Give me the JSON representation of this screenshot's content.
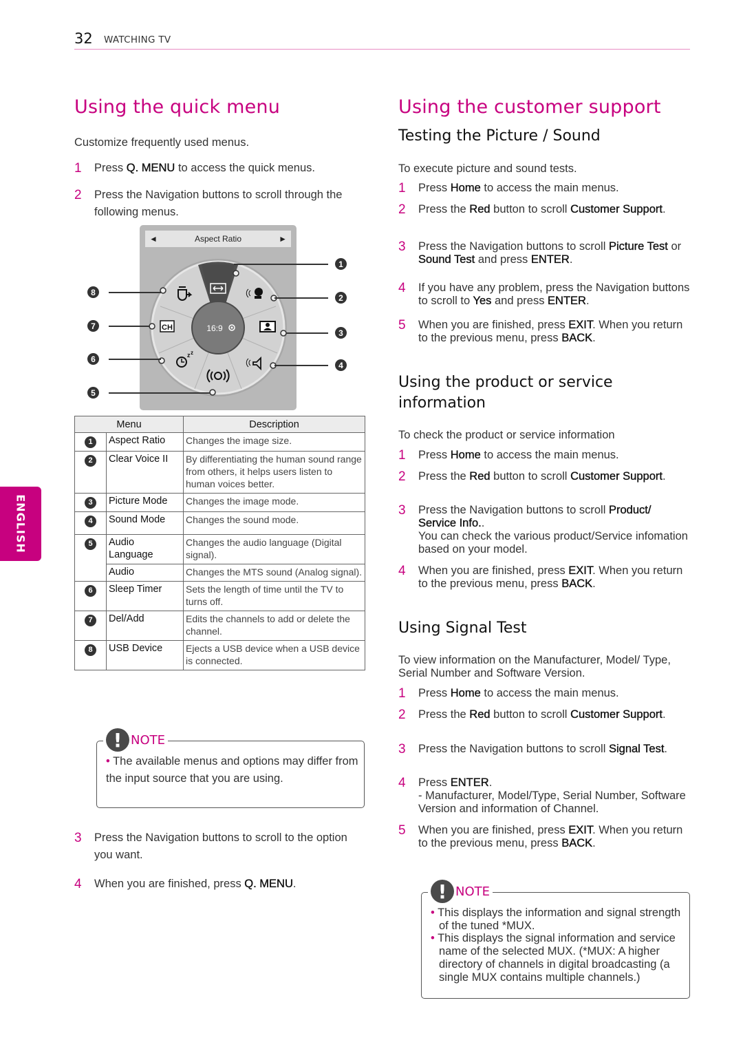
{
  "header": {
    "page_number": "32",
    "chapter": "WATCHING TV"
  },
  "side_tab": {
    "label": "ENGLISH"
  },
  "colors": {
    "accent": "#c7017f",
    "header_line": "#e88cc4"
  },
  "quick_menu": {
    "title": "Using the quick menu",
    "intro": "Customize frequently used menus.",
    "steps": [
      {
        "num": "1",
        "pre": "Press ",
        "b1": "Q. MENU",
        "post": " to access the quick menus."
      },
      {
        "num": "2",
        "text": "Press the Navigation buttons to scroll through the following menus."
      },
      {
        "num": "3",
        "text": "Press the Navigation buttons to scroll to the option you want."
      },
      {
        "num": "4",
        "pre": "When you are finished, press ",
        "b1": "Q. MENU",
        "post": "."
      }
    ],
    "diagram": {
      "title_bar": "Aspect Ratio",
      "left_arrow": "◄",
      "right_arrow": "►",
      "center_label": "16:9 ◉",
      "callouts": [
        "1",
        "2",
        "3",
        "4",
        "5",
        "6",
        "7",
        "8"
      ],
      "icons": [
        "aspect-ratio-icon",
        "clear-voice-icon",
        "picture-mode-icon",
        "sound-mode-icon",
        "audio-icon",
        "sleep-timer-icon",
        "ch-icon",
        "usb-eject-icon"
      ]
    },
    "table": {
      "headers": [
        "Menu",
        "Description"
      ],
      "rows": [
        {
          "num": "1",
          "menu": "Aspect Ratio",
          "desc": "Changes the image size."
        },
        {
          "num": "2",
          "menu": "Clear Voice II",
          "desc": "By differentiating the human sound range from others, it helps users listen to human voices better."
        },
        {
          "num": "3",
          "menu": "Picture Mode",
          "desc": "Changes the image mode."
        },
        {
          "num": "4",
          "menu": "Sound Mode",
          "desc": "Changes the sound mode."
        },
        {
          "num": "5",
          "menu": "Audio Language",
          "desc": "Changes the audio language (Digital signal)."
        },
        {
          "num": "",
          "menu": "Audio",
          "desc": "Changes the MTS sound (Analog signal)."
        },
        {
          "num": "6",
          "menu": "Sleep Timer",
          "desc": "Sets the length of time until the TV to turns off."
        },
        {
          "num": "7",
          "menu": "Del/Add",
          "desc": "Edits the channels to add or delete the channel."
        },
        {
          "num": "8",
          "menu": "USB Device",
          "desc": "Ejects a USB device when a USB device is connected."
        }
      ]
    },
    "note": {
      "label": "NOTE",
      "items": [
        "The available menus and options may differ from the input source that you are using."
      ]
    }
  },
  "customer_support": {
    "title": "Using the customer support",
    "picture_sound": {
      "title": "Testing the Picture / Sound",
      "intro": "To execute picture and sound tests.",
      "steps": [
        {
          "num": "1",
          "pre": "Press ",
          "b1": "Home",
          "post": " to access the main menus."
        },
        {
          "num": "2",
          "pre": "Press the ",
          "b1": "Red",
          "mid": " button to scroll ",
          "b2": "Customer Support",
          "post": "."
        },
        {
          "num": "3",
          "pre": "Press the Navigation buttons to scroll ",
          "b1": "Picture Test",
          "mid": " or ",
          "b2": "Sound Test",
          "mid2": " and press ",
          "b3": "ENTER",
          "post": "."
        },
        {
          "num": "4",
          "pre": "If you have any problem, press the Navigation buttons to scroll to ",
          "b1": "Yes",
          "mid": " and press ",
          "b2": "ENTER",
          "post": "."
        },
        {
          "num": "5",
          "pre": "When you are finished, press ",
          "b1": "EXIT",
          "mid": ". When you return to the previous menu, press ",
          "b2": "BACK",
          "post": "."
        }
      ]
    },
    "product_info": {
      "title": "Using the product or service information",
      "intro": "To check the product or service information",
      "steps": [
        {
          "num": "1",
          "pre": "Press ",
          "b1": "Home",
          "post": " to access the main menus."
        },
        {
          "num": "2",
          "pre": "Press the ",
          "b1": "Red",
          "mid": " button to scroll ",
          "b2": "Customer Support",
          "post": "."
        },
        {
          "num": "3",
          "pre": "Press the Navigation buttons to scroll ",
          "b1": "Product/ Service Info.",
          "post": ".",
          "extra": "You can check the various product/Service infomation based on your model."
        },
        {
          "num": "4",
          "pre": "When you are finished, press ",
          "b1": "EXIT",
          "mid": ". When you return to the previous menu, press ",
          "b2": "BACK",
          "post": "."
        }
      ]
    },
    "signal_test": {
      "title": "Using Signal Test",
      "intro": "To view information on the Manufacturer, Model/ Type, Serial Number and Software Version.",
      "steps": [
        {
          "num": "1",
          "pre": "Press ",
          "b1": "Home",
          "post": " to access the main menus."
        },
        {
          "num": "2",
          "pre": "Press the ",
          "b1": "Red",
          "mid": " button to scroll ",
          "b2": "Customer Support",
          "post": "."
        },
        {
          "num": "3",
          "pre": "Press the Navigation buttons to scroll ",
          "b1": "Signal Test",
          "post": "."
        },
        {
          "num": "4",
          "pre": "Press ",
          "b1": "ENTER",
          "post": ".",
          "extra": "- Manufacturer, Model/Type, Serial Number, Software Version and information of Channel."
        },
        {
          "num": "5",
          "pre": "When you are finished, press ",
          "b1": "EXIT",
          "mid": ". When you return to the previous menu, press ",
          "b2": "BACK",
          "post": "."
        }
      ]
    },
    "note": {
      "label": "NOTE",
      "items": [
        "This displays the information and signal strength of the tuned *MUX.",
        "This displays the signal information and service name of the selected MUX. (*MUX: A higher directory of channels in digital broadcasting (a single MUX contains multiple channels.)"
      ]
    }
  }
}
